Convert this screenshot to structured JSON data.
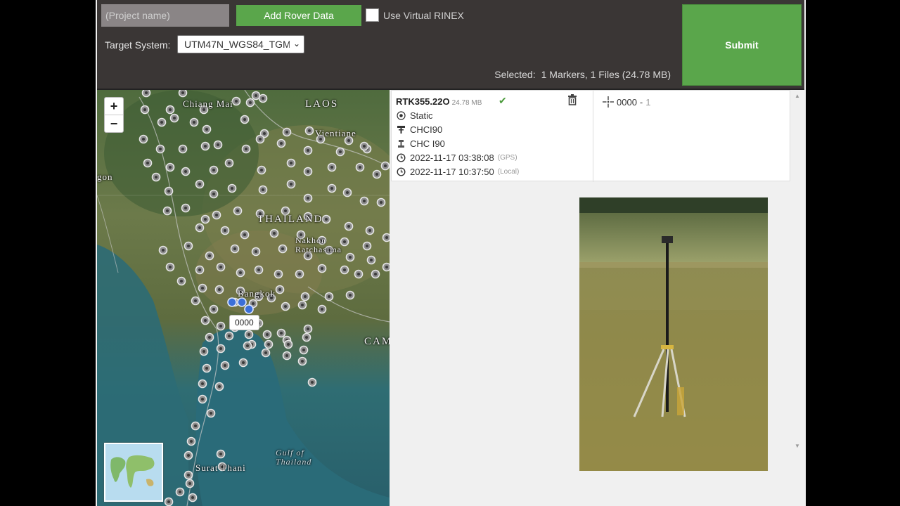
{
  "topbar": {
    "project_placeholder": "(Project name)",
    "add_rover_label": "Add Rover Data",
    "virtual_rinex_label": "Use Virtual RINEX",
    "target_system_label": "Target System:",
    "target_system_value": "UTM47N_WGS84_TGM",
    "selected_label": "Selected:",
    "selected_value": "1 Markers, 1 Files (24.78 MB)",
    "submit_label": "Submit"
  },
  "map": {
    "zoom_in": "+",
    "zoom_out": "−",
    "labels": {
      "chiang_mai": "Chiang Mai",
      "laos": "LAOS",
      "vientiane": "Vientiane",
      "yangon": "gon",
      "thailand": "THAILAND",
      "nakhon": "Nakhon Ratchasima",
      "bangkok": "Bangkok",
      "cambodia": "CAM",
      "gulf": "Gulf of Thailand",
      "surat": "Surat Thani"
    },
    "tooltip": "0000",
    "colors": {
      "marker": "#b9b9b9",
      "selected_marker": "#3b6fd8"
    }
  },
  "file": {
    "name": "RTK355.22O",
    "size": "24.78 MB",
    "mode": "Static",
    "antenna": "CHCI90",
    "receiver": "CHC I90",
    "gps_time": "2022-11-17 03:38:08",
    "gps_tag": "(GPS)",
    "local_time": "2022-11-17 10:37:50",
    "local_tag": "(Local)"
  },
  "marker": {
    "name": "0000",
    "sep": "-",
    "count": "1"
  },
  "colors": {
    "accent": "#5aa64b",
    "topbar": "#3a3635"
  }
}
